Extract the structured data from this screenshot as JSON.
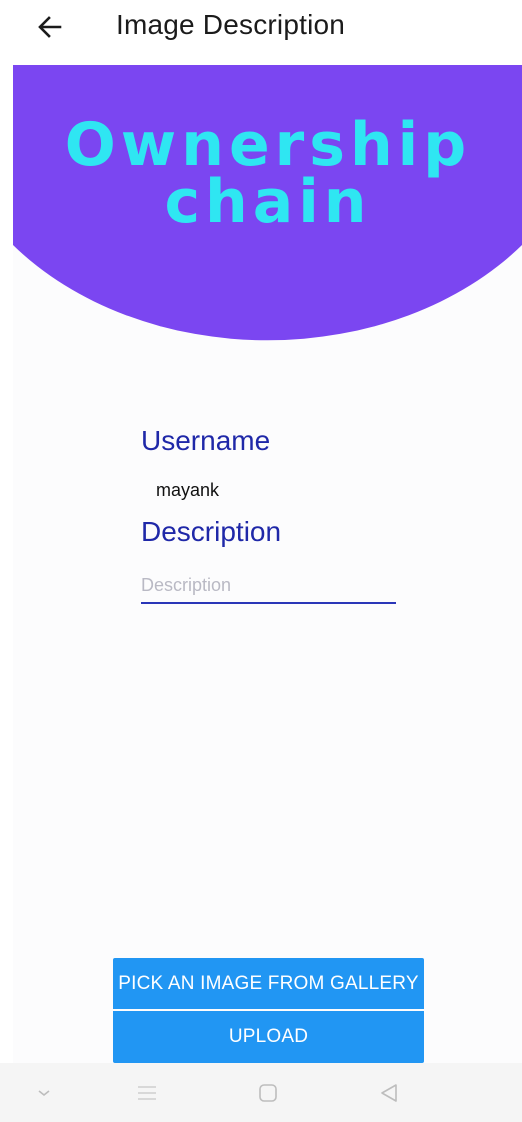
{
  "app_bar": {
    "title": "Image Description",
    "back_icon": "arrow-back-icon"
  },
  "banner": {
    "line1": "Ownership",
    "line2": "chain",
    "bg_color": "#7b46f1",
    "text_color": "#2fe6f2"
  },
  "form": {
    "username_label": "Username",
    "username_value": "mayank",
    "description_label": "Description",
    "description_placeholder": "Description",
    "description_value": ""
  },
  "buttons": {
    "pick_label": "PICK AN IMAGE FROM GALLERY",
    "upload_label": "UPLOAD",
    "color": "#2196f3"
  },
  "nav_bar": {
    "icons": [
      "chevron-down-icon",
      "menu-icon",
      "home-icon",
      "back-triangle-icon"
    ]
  }
}
